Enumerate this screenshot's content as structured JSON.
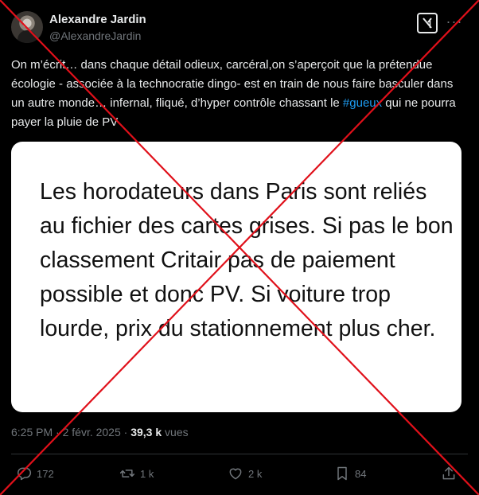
{
  "author": {
    "name": "Alexandre Jardin",
    "handle": "@AlexandreJardin"
  },
  "tweet": {
    "text_before": "On m’écrit… dans chaque détail odieux, carcéral,on s’aperçoit que la prétendue écologie - associée à la technocratie dingo- est en train de nous faire basculer dans un autre monde… infernal, fliqué, d’hyper contrôle chassant le ",
    "hashtag": "#gueux",
    "text_after": " qui ne pourra payer la pluie de PV"
  },
  "media": {
    "text": "Les horodateurs dans Paris sont reliés au fichier des cartes grises. Si pas le bon classement Critair pas de paiement possible et donc PV. Si voiture trop lourde, prix du stationnement plus cher."
  },
  "meta": {
    "time": "6:25 PM",
    "separator": " · ",
    "date": "2 févr. 2025",
    "dot": " · ",
    "views_count": "39,3 k",
    "views_label": " vues"
  },
  "actions": {
    "replies": "172",
    "reposts": "1 k",
    "likes": "2 k",
    "bookmarks": "84"
  },
  "icons": {
    "grok": "grok-icon",
    "more": "more-icon",
    "reply": "reply-icon",
    "repost": "repost-icon",
    "like": "heart-icon",
    "bookmark": "bookmark-icon",
    "share": "share-icon"
  },
  "colors": {
    "background": "#000000",
    "text": "#e7e9ea",
    "secondary": "#71767b",
    "link": "#1d9bf0",
    "cross": "#e0101a"
  }
}
